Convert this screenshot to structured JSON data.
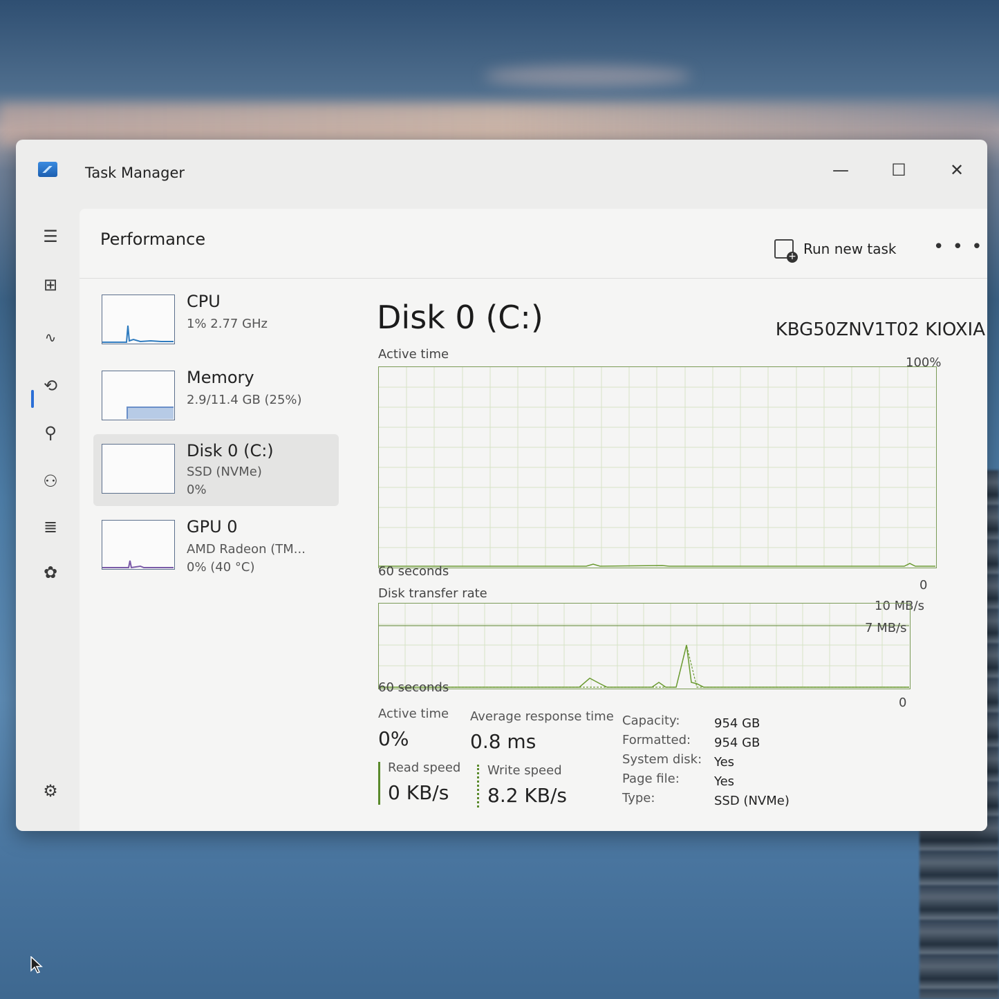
{
  "window": {
    "title": "Task Manager",
    "minimize_label": "—",
    "maximize_label": "☐",
    "close_label": "✕"
  },
  "nav": {
    "items": [
      {
        "name": "menu-icon",
        "glyph": "☰"
      },
      {
        "name": "processes-icon",
        "glyph": "⊞"
      },
      {
        "name": "performance-icon",
        "glyph": "∿"
      },
      {
        "name": "app-history-icon",
        "glyph": "⟲"
      },
      {
        "name": "startup-apps-icon",
        "glyph": "⚲"
      },
      {
        "name": "users-icon",
        "glyph": "⚇"
      },
      {
        "name": "details-icon",
        "glyph": "≣"
      },
      {
        "name": "services-icon",
        "glyph": "✿"
      }
    ],
    "settings_glyph": "⚙"
  },
  "header": {
    "page_title": "Performance",
    "run_new_task": "Run new task",
    "more": "• • •"
  },
  "devices": [
    {
      "name": "CPU",
      "line1": "1%  2.77 GHz",
      "line2": ""
    },
    {
      "name": "Memory",
      "line1": "2.9/11.4 GB (25%)",
      "line2": ""
    },
    {
      "name": "Disk 0 (C:)",
      "line1": "SSD (NVMe)",
      "line2": "0%"
    },
    {
      "name": "GPU 0",
      "line1": "AMD Radeon (TM...",
      "line2": "0%  (40 °C)"
    }
  ],
  "detail": {
    "title": "Disk 0 (C:)",
    "model": "KBG50ZNV1T02 KIOXIA",
    "active_time_graph": {
      "label": "Active time",
      "max_label": "100%",
      "time_label": "60 seconds",
      "min_label": "0"
    },
    "transfer_graph": {
      "label": "Disk transfer rate",
      "max_label": "10 MB/s",
      "ref_label": "7 MB/s",
      "time_label": "60 seconds",
      "min_label": "0"
    },
    "stats": {
      "active_time_label": "Active time",
      "active_time_value": "0%",
      "avg_response_label": "Average response time",
      "avg_response_value": "0.8 ms",
      "read_speed_label": "Read speed",
      "read_speed_value": "0 KB/s",
      "write_speed_label": "Write speed",
      "write_speed_value": "8.2 KB/s"
    },
    "properties": [
      {
        "label": "Capacity:",
        "value": "954 GB"
      },
      {
        "label": "Formatted:",
        "value": "954 GB"
      },
      {
        "label": "System disk:",
        "value": "Yes"
      },
      {
        "label": "Page file:",
        "value": "Yes"
      },
      {
        "label": "Type:",
        "value": "SSD (NVMe)"
      }
    ]
  },
  "colors": {
    "accent": "#2b6fd6",
    "disk_graph": "#7a9a55",
    "cpu_graph": "#2e7bbf",
    "memory_graph": "#6a8fc8",
    "gpu_graph": "#7a5aa8"
  }
}
